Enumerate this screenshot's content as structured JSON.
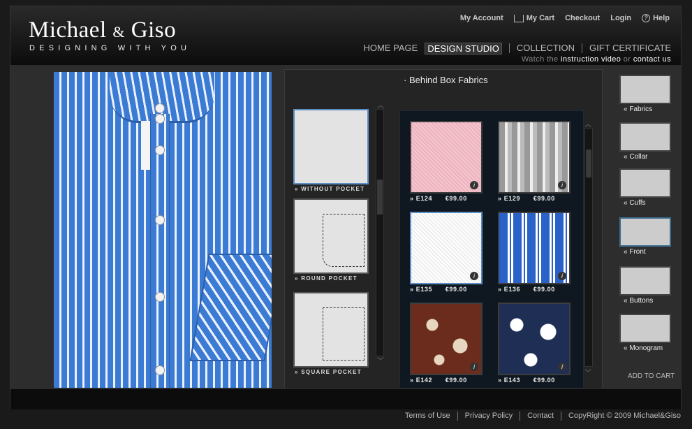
{
  "brand": {
    "name_left": "Michael",
    "amp": "&",
    "name_right": "Giso",
    "tagline": "DESIGNING WITH YOU"
  },
  "toplinks": [
    "My Account",
    "My Cart",
    "Checkout",
    "Login",
    "Help"
  ],
  "mainnav": [
    "HOME PAGE",
    "DESIGN STUDIO",
    "COLLECTION",
    "GIFT CERTIFICATE"
  ],
  "subnav": {
    "prefix": "Watch the",
    "video": "instruction video",
    "mid": "or",
    "contact": "contact us"
  },
  "panel_title": "Behind Box Fabrics",
  "pockets": [
    "WITHOUT POCKET",
    "ROUND POCKET",
    "SQUARE POCKET"
  ],
  "fabrics": [
    {
      "code": "E124",
      "price": "€99.00"
    },
    {
      "code": "E129",
      "price": "€99.00"
    },
    {
      "code": "E135",
      "price": "€99.00"
    },
    {
      "code": "E136",
      "price": "€99.00"
    },
    {
      "code": "E142",
      "price": "€99.00"
    },
    {
      "code": "E143",
      "price": "€99.00"
    }
  ],
  "sidebar": [
    "Fabrics",
    "Collar",
    "Cuffs",
    "Front",
    "Buttons",
    "Monogram"
  ],
  "add_to_cart": "ADD TO CART",
  "footer": [
    "Terms of Use",
    "Privacy Policy",
    "Contact",
    "CopyRight © 2009 Michael&Giso"
  ]
}
